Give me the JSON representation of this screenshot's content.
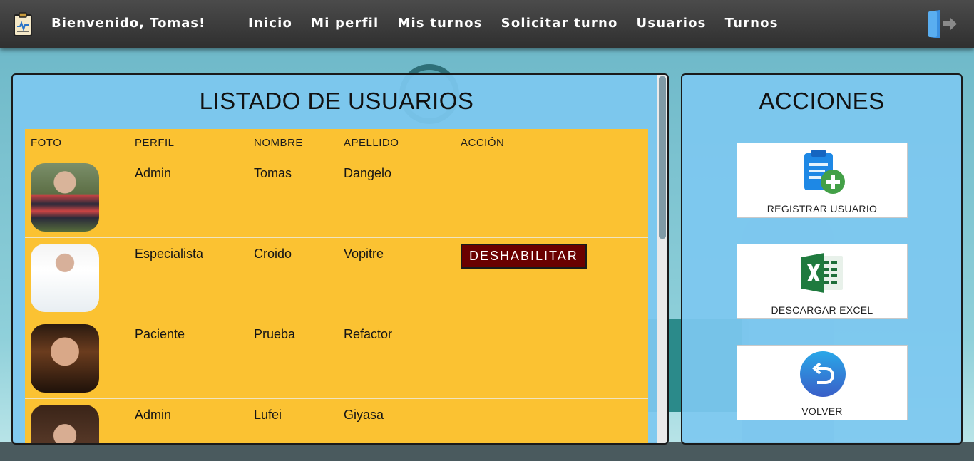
{
  "header": {
    "welcome": "Bienvenido, Tomas!",
    "nav": [
      "Inicio",
      "Mi perfil",
      "Mis turnos",
      "Solicitar turno",
      "Usuarios",
      "Turnos"
    ],
    "logo_icon": "clipboard-heart-icon",
    "logout_icon": "logout-icon"
  },
  "users": {
    "title": "LISTADO DE USUARIOS",
    "columns": [
      "FOTO",
      "PERFIL",
      "NOMBRE",
      "APELLIDO",
      "ACCIÓN"
    ],
    "rows": [
      {
        "perfil": "Admin",
        "nombre": "Tomas",
        "apellido": "Dangelo",
        "accion": ""
      },
      {
        "perfil": "Especialista",
        "nombre": "Croido",
        "apellido": "Vopitre",
        "accion": "DESHABILITAR"
      },
      {
        "perfil": "Paciente",
        "nombre": "Prueba",
        "apellido": "Refactor",
        "accion": ""
      },
      {
        "perfil": "Admin",
        "nombre": "Lufei",
        "apellido": "Giyasa",
        "accion": ""
      }
    ]
  },
  "actions": {
    "title": "ACCIONES",
    "register_label": "REGISTRAR USUARIO",
    "excel_label": "DESCARGAR EXCEL",
    "back_label": "VOLVER"
  },
  "colors": {
    "navbar": "#3a3a3a",
    "panel": "#7dc8f0",
    "table": "#fbc232",
    "danger_button": "#6a0000"
  }
}
